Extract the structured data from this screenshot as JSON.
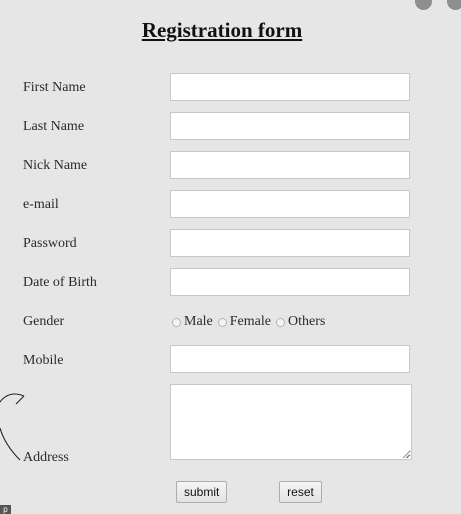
{
  "form": {
    "title": "Registration form",
    "fields": {
      "first_name": {
        "label": "First Name",
        "value": ""
      },
      "last_name": {
        "label": "Last Name",
        "value": ""
      },
      "nick_name": {
        "label": "Nick Name",
        "value": ""
      },
      "email": {
        "label": "e-mail",
        "value": ""
      },
      "password": {
        "label": "Password",
        "value": ""
      },
      "dob": {
        "label": "Date of Birth",
        "value": ""
      },
      "mobile": {
        "label": "Mobile",
        "value": ""
      },
      "address": {
        "label": "Address",
        "value": ""
      }
    },
    "gender": {
      "label": "Gender",
      "options": [
        "Male",
        "Female",
        "Others"
      ],
      "selected": null
    },
    "buttons": {
      "submit": "submit",
      "reset": "reset"
    }
  },
  "misc": {
    "corner_mark": "p"
  },
  "colors": {
    "background": "#e6e6e6",
    "field_border": "#c8c8c8",
    "annotation_stroke": "#222222"
  }
}
